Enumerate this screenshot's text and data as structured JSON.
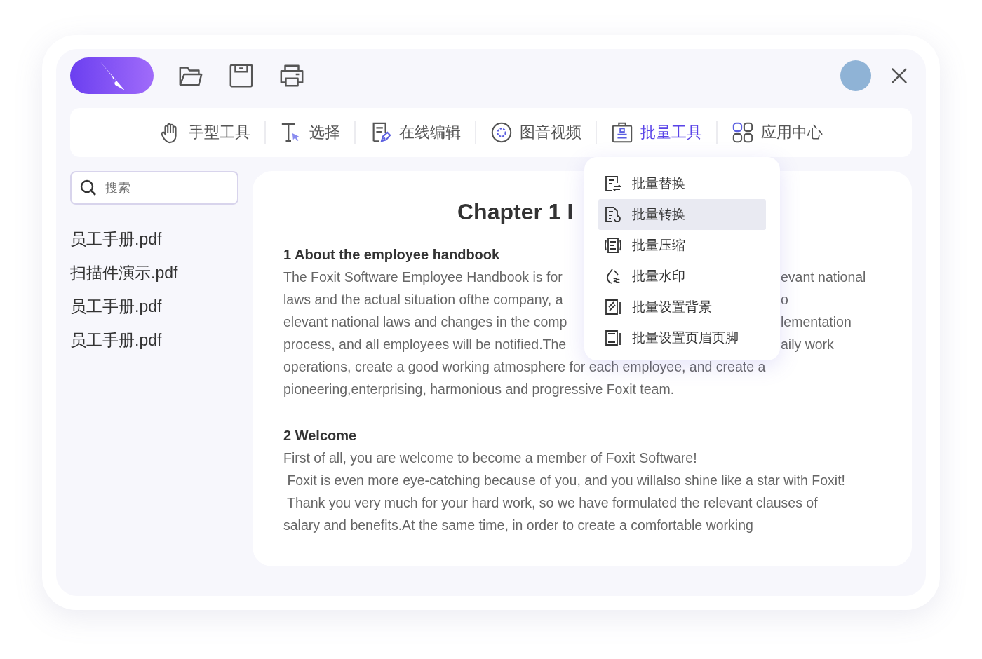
{
  "toolbar": {
    "tabs": [
      {
        "label": "手型工具",
        "selected": false
      },
      {
        "label": "选择",
        "selected": false
      },
      {
        "label": "在线编辑",
        "selected": false
      },
      {
        "label": "图音视频",
        "selected": false
      },
      {
        "label": "批量工具",
        "selected": true
      },
      {
        "label": "应用中心",
        "selected": false
      }
    ]
  },
  "search": {
    "placeholder": "搜索"
  },
  "files": [
    "员工手册.pdf",
    "扫描件演示.pdf",
    "员工手册.pdf",
    "员工手册.pdf"
  ],
  "document": {
    "title": "Chapter 1 I",
    "sections": [
      {
        "heading": "1 About the employee handbook",
        "lines": [
          {
            "left": "The Foxit Software Employee Handbook is for",
            "right": "evant national"
          },
          {
            "left": "laws and the actual situation ofthe company, a",
            "right": "o"
          },
          {
            "left": "elevant national laws and changes in the comp",
            "right": "lementation"
          },
          {
            "left": "process, and all employees will be notified.The",
            "right": "aily work"
          },
          {
            "left": "operations, create a good working atmosphere for each employee, and create a"
          },
          {
            "left": "pioneering,enterprising, harmonious and progressive Foxit team."
          }
        ]
      },
      {
        "heading": "2 Welcome",
        "lines": [
          {
            "left": "First of all, you are welcome to become a member of Foxit Software!"
          },
          {
            "left": " Foxit is even more eye-catching because of you, and you willalso shine like a star with Foxit!"
          },
          {
            "left": " Thank you very much for your hard work, so we have formulated the relevant clauses of"
          },
          {
            "left": "salary and benefits.At the same time, in order to create a comfortable working"
          }
        ]
      }
    ]
  },
  "menu": {
    "items": [
      {
        "label": "批量替换",
        "selected": false
      },
      {
        "label": "批量转换",
        "selected": true
      },
      {
        "label": "批量压缩",
        "selected": false
      },
      {
        "label": "批量水印",
        "selected": false
      },
      {
        "label": "批量设置背景",
        "selected": false
      },
      {
        "label": "批量设置页眉页脚",
        "selected": false
      }
    ]
  }
}
